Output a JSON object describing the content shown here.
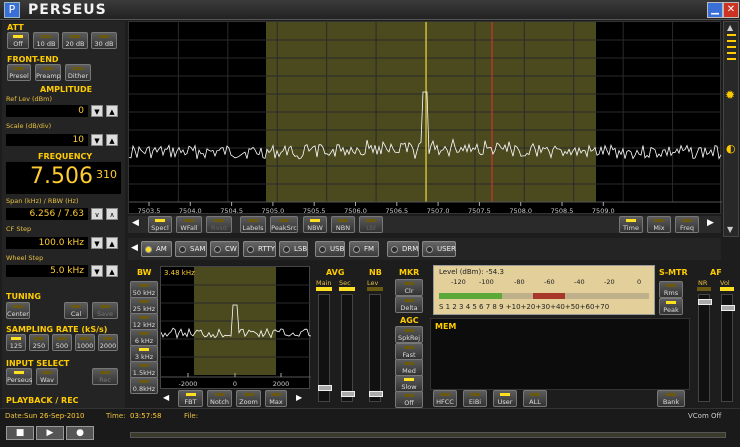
{
  "app": {
    "title": "PERSEUS"
  },
  "att": {
    "title": "ATT",
    "buttons": [
      "Off",
      "10 dB",
      "20 dB",
      "30 dB"
    ]
  },
  "frontend": {
    "title": "FRONT-END",
    "buttons": [
      "Presel",
      "Preamp",
      "Dither"
    ]
  },
  "amplitude": {
    "title": "AMPLITUDE",
    "ref_label": "Ref Lev (dBm)",
    "ref_value": "0",
    "scale_label": "Scale (dB/div)",
    "scale_value": "10"
  },
  "frequency": {
    "title": "FREQUENCY",
    "main": "7.506",
    "sub": "310",
    "span_label": "Span (kHz) / RBW (Hz)",
    "span_value": "6.256 / 7.63",
    "cf_label": "CF Step",
    "cf_value": "100.0 kHz",
    "wheel_label": "Wheel Step",
    "wheel_value": "5.0 kHz"
  },
  "tuning": {
    "title": "TUNING",
    "buttons": [
      "Center",
      "Cal",
      "Save"
    ]
  },
  "sampling": {
    "title": "SAMPLING RATE (kS/s)",
    "buttons": [
      "125",
      "250",
      "500",
      "1000",
      "2000"
    ]
  },
  "input": {
    "title": "INPUT SELECT",
    "buttons": [
      "Perseus",
      "Wav",
      "Rec"
    ]
  },
  "playback": {
    "title": "PLAYBACK / REC"
  },
  "spectrum": {
    "ticks": [
      "7503.5",
      "7504.0",
      "7504.5",
      "7505.0",
      "7505.5",
      "7506.0",
      "7506.5",
      "7507.0",
      "7507.5",
      "7508.0",
      "7508.5",
      "7509.0"
    ],
    "buttons_left": [
      "Specl",
      "WFall",
      "Rvsd"
    ],
    "buttons_mid": [
      "Labels",
      "PeakSrc",
      "NBW",
      "NBN",
      "Lbl"
    ],
    "buttons_right": [
      "Time",
      "Mix",
      "Freq"
    ]
  },
  "modes": [
    "AM",
    "SAM",
    "CW",
    "RTTY",
    "LSB",
    "USB",
    "FM",
    "DRM",
    "USER"
  ],
  "active_mode": "AM",
  "bw": {
    "title": "BW",
    "value": "3.48 kHz",
    "buttons": [
      "50 kHz",
      "25 kHz",
      "12 kHz",
      "6 kHz",
      "3 kHz",
      "1.5kHz",
      "0.8kHz"
    ],
    "ticks": [
      "-2000",
      "0",
      "2000"
    ],
    "buttons_bottom": [
      "FBT",
      "Notch",
      "Zoom",
      "Max"
    ]
  },
  "avg": {
    "title": "AVG",
    "main": "Main",
    "sec": "Sec"
  },
  "nb": {
    "title": "NB",
    "lev": "Lev"
  },
  "mkr": {
    "title": "MKR",
    "buttons": [
      "Clr",
      "Delta"
    ]
  },
  "agc": {
    "title": "AGC",
    "buttons": [
      "SpkRej",
      "Fast",
      "Med",
      "Slow",
      "Off"
    ]
  },
  "meter": {
    "level_label": "Level (dBm): -54.3",
    "dbm_scale": [
      "-120",
      "-100",
      "-80",
      "-60",
      "-40",
      "-20",
      "0"
    ],
    "s_scale": "S 1 2 3 4 5 6 7 8 9 +10+20+30+40+50+60+70",
    "level_fraction": 0.3
  },
  "smtr": {
    "title": "S-MTR",
    "buttons": [
      "Rms",
      "Peak"
    ]
  },
  "af": {
    "title": "AF",
    "nr": "NR",
    "vol": "Vol"
  },
  "mem": {
    "title": "MEM",
    "buttons": [
      "HFCC",
      "EiBi",
      "User",
      "ALL"
    ],
    "bank": "Bank"
  },
  "status": {
    "date_label": "Date:",
    "date_value": "Sun 26-Sep-2010",
    "time_label": "Time:",
    "time_value": "03:57:58",
    "file_label": "File:",
    "vcom": "VCom Off"
  },
  "colors": {
    "accent": "#ffcc00",
    "trace": "#ffffff",
    "bandpass": "#5a5a2a",
    "marker": "#ffe040",
    "cursor": "#e03030"
  }
}
